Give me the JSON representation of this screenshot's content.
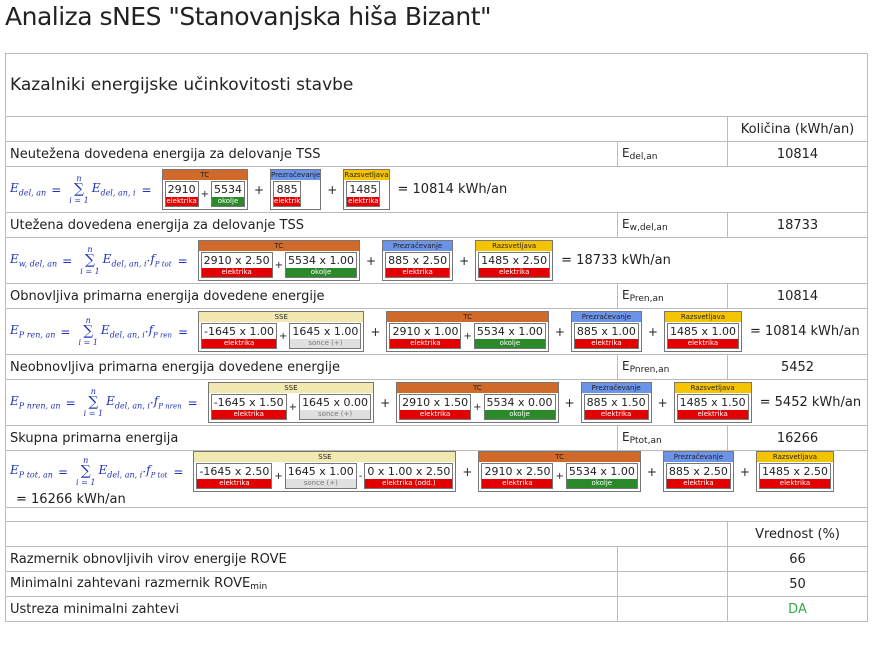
{
  "title": "Analiza sNES \"Stanovanjska hiša Bizant\"",
  "section1": {
    "heading": "Kazalniki energijske učinkovitosti stavbe",
    "col_header": "Količina (kWh/an)",
    "rows": [
      {
        "label": "Neutežena dovedena energija za delovanje TSS",
        "sym": "E",
        "sub": "del,an",
        "value": "10814"
      },
      {
        "label": "Utežena dovedena energija za delovanje TSS",
        "sym": "E",
        "sub": "w,del,an",
        "value": "18733"
      },
      {
        "label": "Obnovljiva primarna energija dovedene energije",
        "sym": "E",
        "sub": "Pren,an",
        "value": "10814"
      },
      {
        "label": "Neobnovljiva primarna energija dovedene energije",
        "sym": "E",
        "sub": "Pnren,an",
        "value": "5452"
      },
      {
        "label": "Skupna primarna energija",
        "sym": "E",
        "sub": "Ptot,an",
        "value": "16266"
      }
    ],
    "formulas": [
      {
        "lhs": "E",
        "lhs_sub": "del, an",
        "rhs": "E",
        "rhs_sub": "del, an, i",
        "factor": "",
        "factor_sub": "",
        "result": "= 10814 kWh/an",
        "groups": [
          {
            "name": "TC",
            "color": "tc",
            "cells": [
              {
                "v": "2910",
                "t": "elektrika",
                "k": "el"
              },
              {
                "v": "5534",
                "t": "okolje",
                "k": "ok"
              }
            ]
          },
          {
            "name": "Prezračevanje",
            "color": "blue",
            "cells": [
              {
                "v": "885",
                "t": "elektrik",
                "k": "el"
              }
            ]
          },
          {
            "name": "Razsvetljava",
            "color": "yellow",
            "cells": [
              {
                "v": "1485",
                "t": "elektrika",
                "k": "el"
              }
            ]
          }
        ]
      },
      {
        "lhs": "E",
        "lhs_sub": "w, del, an",
        "rhs": "E",
        "rhs_sub": "del, an, i",
        "factor": "f",
        "factor_sub": "P tot",
        "result": "= 18733 kWh/an",
        "groups": [
          {
            "name": "TC",
            "color": "tc",
            "cells": [
              {
                "v": "2910 x 2.50",
                "t": "elektrika",
                "k": "el"
              },
              {
                "v": "5534 x 1.00",
                "t": "okolje",
                "k": "ok"
              }
            ]
          },
          {
            "name": "Prezračevanje",
            "color": "blue",
            "cells": [
              {
                "v": "885 x 2.50",
                "t": "elektrika",
                "k": "el"
              }
            ]
          },
          {
            "name": "Razsvetljava",
            "color": "yellow",
            "cells": [
              {
                "v": "1485 x 2.50",
                "t": "elektrika",
                "k": "el"
              }
            ]
          }
        ]
      },
      {
        "lhs": "E",
        "lhs_sub": "P ren, an",
        "rhs": "E",
        "rhs_sub": "del, an, i",
        "factor": "f",
        "factor_sub": "P ren",
        "result": "= 10814 kWh/an",
        "groups": [
          {
            "name": "SSE",
            "color": "gray",
            "cells": [
              {
                "v": "-1645 x 1.00",
                "t": "elektrika",
                "k": "el"
              },
              {
                "v": "1645 x 1.00",
                "t": "sonce (+)",
                "k": "son"
              }
            ]
          },
          {
            "name": "TC",
            "color": "tc",
            "cells": [
              {
                "v": "2910 x 1.00",
                "t": "elektrika",
                "k": "el"
              },
              {
                "v": "5534 x 1.00",
                "t": "okolje",
                "k": "ok"
              }
            ]
          },
          {
            "name": "Prezračevanje",
            "color": "blue",
            "cells": [
              {
                "v": "885 x 1.00",
                "t": "elektrika",
                "k": "el"
              }
            ]
          },
          {
            "name": "Razsvetljava",
            "color": "yellow",
            "cells": [
              {
                "v": "1485 x 1.00",
                "t": "elektrika",
                "k": "el"
              }
            ]
          }
        ]
      },
      {
        "lhs": "E",
        "lhs_sub": "P nren, an",
        "rhs": "E",
        "rhs_sub": "del, an, i",
        "factor": "f",
        "factor_sub": "P nren",
        "result": "= 5452 kWh/an",
        "groups": [
          {
            "name": "SSE",
            "color": "gray",
            "cells": [
              {
                "v": "-1645 x 1.50",
                "t": "elektrika",
                "k": "el"
              },
              {
                "v": "1645 x 0.00",
                "t": "sonce (+)",
                "k": "son"
              }
            ]
          },
          {
            "name": "TC",
            "color": "tc",
            "cells": [
              {
                "v": "2910 x 1.50",
                "t": "elektrika",
                "k": "el"
              },
              {
                "v": "5534 x 0.00",
                "t": "okolje",
                "k": "ok"
              }
            ]
          },
          {
            "name": "Prezračevanje",
            "color": "blue",
            "cells": [
              {
                "v": "885 x 1.50",
                "t": "elektrika",
                "k": "el"
              }
            ]
          },
          {
            "name": "Razsvetljava",
            "color": "yellow",
            "cells": [
              {
                "v": "1485 x 1.50",
                "t": "elektrika",
                "k": "el"
              }
            ]
          }
        ]
      },
      {
        "lhs": "E",
        "lhs_sub": "P tot, an",
        "rhs": "E",
        "rhs_sub": "del, an, i",
        "factor": "f",
        "factor_sub": "P tot",
        "result": "= 16266 kWh/an",
        "groups": [
          {
            "name": "SSE",
            "color": "gray",
            "cells": [
              {
                "v": "-1645 x 2.50",
                "t": "elektrika",
                "k": "el"
              },
              {
                "v": "1645 x 1.00",
                "t": "sonce (+)",
                "k": "son"
              },
              {
                "v": "0 x 1.00 x 2.50",
                "t": "elektrika (odd.)",
                "k": "el"
              }
            ]
          },
          {
            "name": "TC",
            "color": "tc",
            "cells": [
              {
                "v": "2910 x 2.50",
                "t": "elektrika",
                "k": "el"
              },
              {
                "v": "5534 x 1.00",
                "t": "okolje",
                "k": "ok"
              }
            ]
          },
          {
            "name": "Prezračevanje",
            "color": "blue",
            "cells": [
              {
                "v": "885 x 2.50",
                "t": "elektrika",
                "k": "el"
              }
            ]
          },
          {
            "name": "Razsvetljava",
            "color": "yellow",
            "cells": [
              {
                "v": "1485 x 2.50",
                "t": "elektrika",
                "k": "el"
              }
            ]
          }
        ]
      }
    ]
  },
  "sum_upper": "n",
  "sum_lower": "i = 1",
  "section2": {
    "col_header": "Vrednost (%)",
    "rows": [
      {
        "label": "Razmernik obnovljivih virov energije ROVE",
        "value": "66"
      },
      {
        "label": "Minimalni zahtevani razmernik ROVE",
        "label_sub": "min",
        "value": "50"
      },
      {
        "label": "Ustreza minimalni zahtevi",
        "value": "DA",
        "value_color": "#3aa84a"
      }
    ]
  }
}
